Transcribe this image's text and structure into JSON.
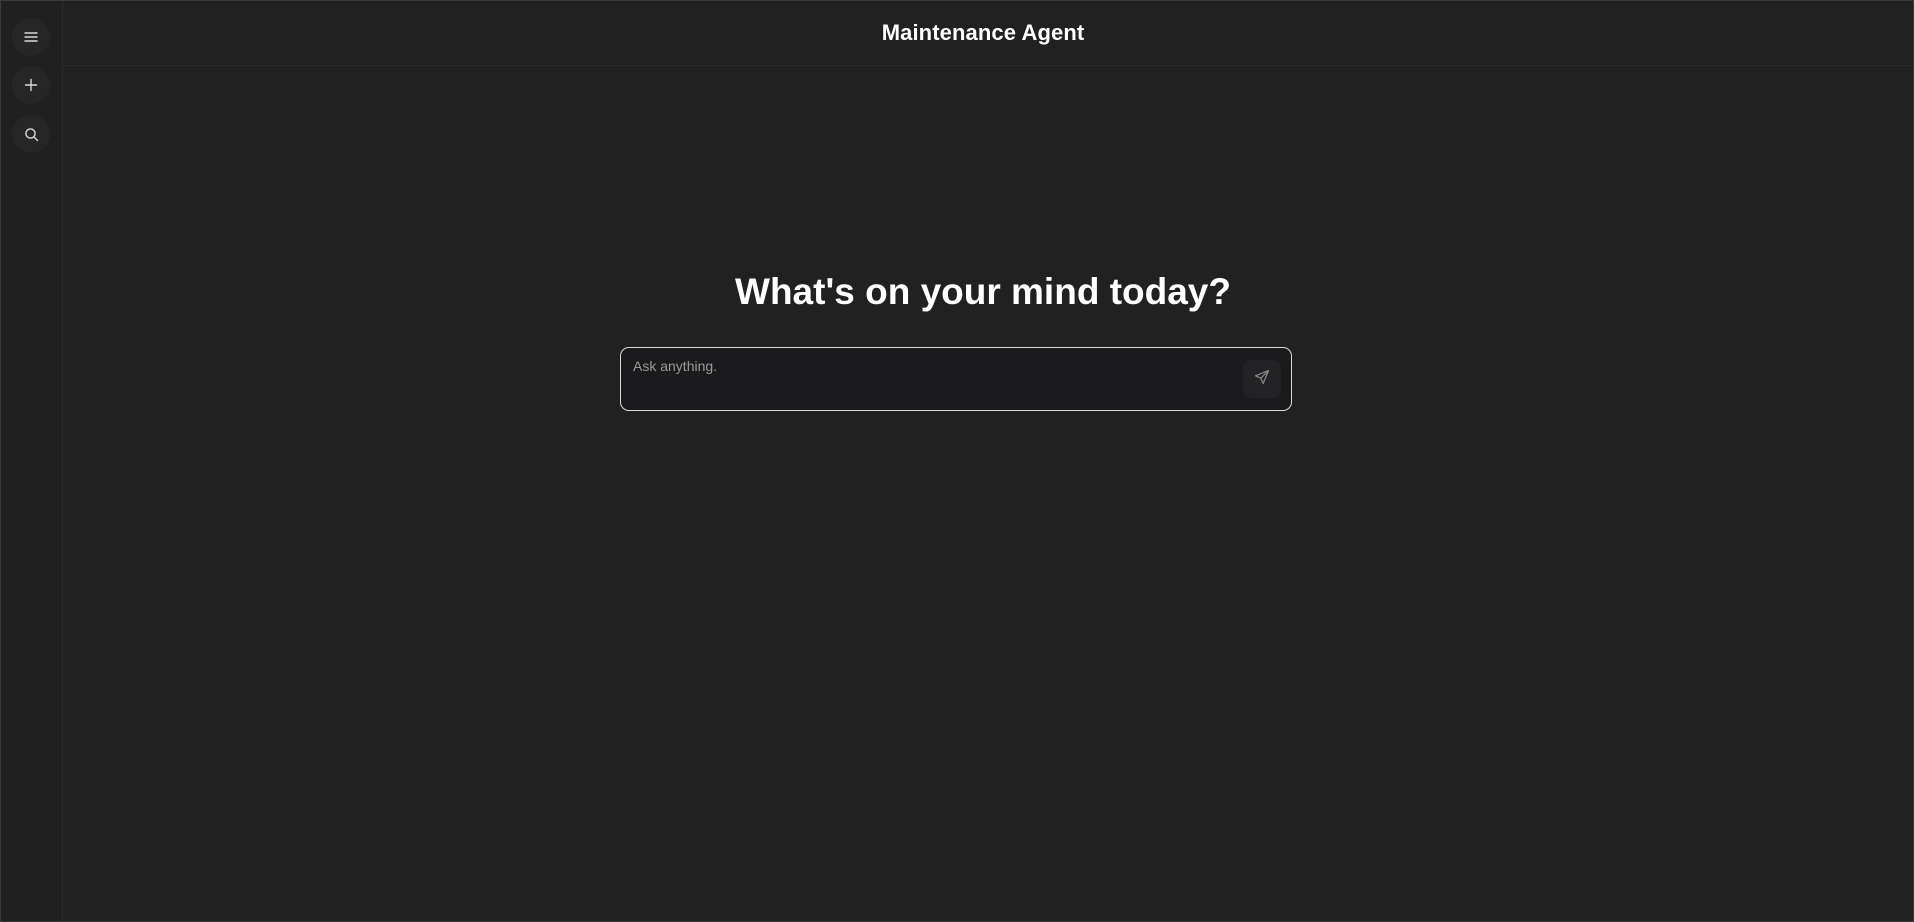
{
  "header": {
    "title": "Maintenance Agent"
  },
  "sidebar": {
    "items": [
      {
        "icon": "menu-icon"
      },
      {
        "icon": "plus-icon"
      },
      {
        "icon": "search-icon"
      }
    ]
  },
  "main": {
    "heading": "What's on your mind today?",
    "composer": {
      "placeholder": "Ask anything.",
      "value": ""
    },
    "send_icon": "send-icon"
  },
  "colors": {
    "background": "#212121",
    "input_border": "#d9d9d9",
    "text": "#ffffff"
  }
}
